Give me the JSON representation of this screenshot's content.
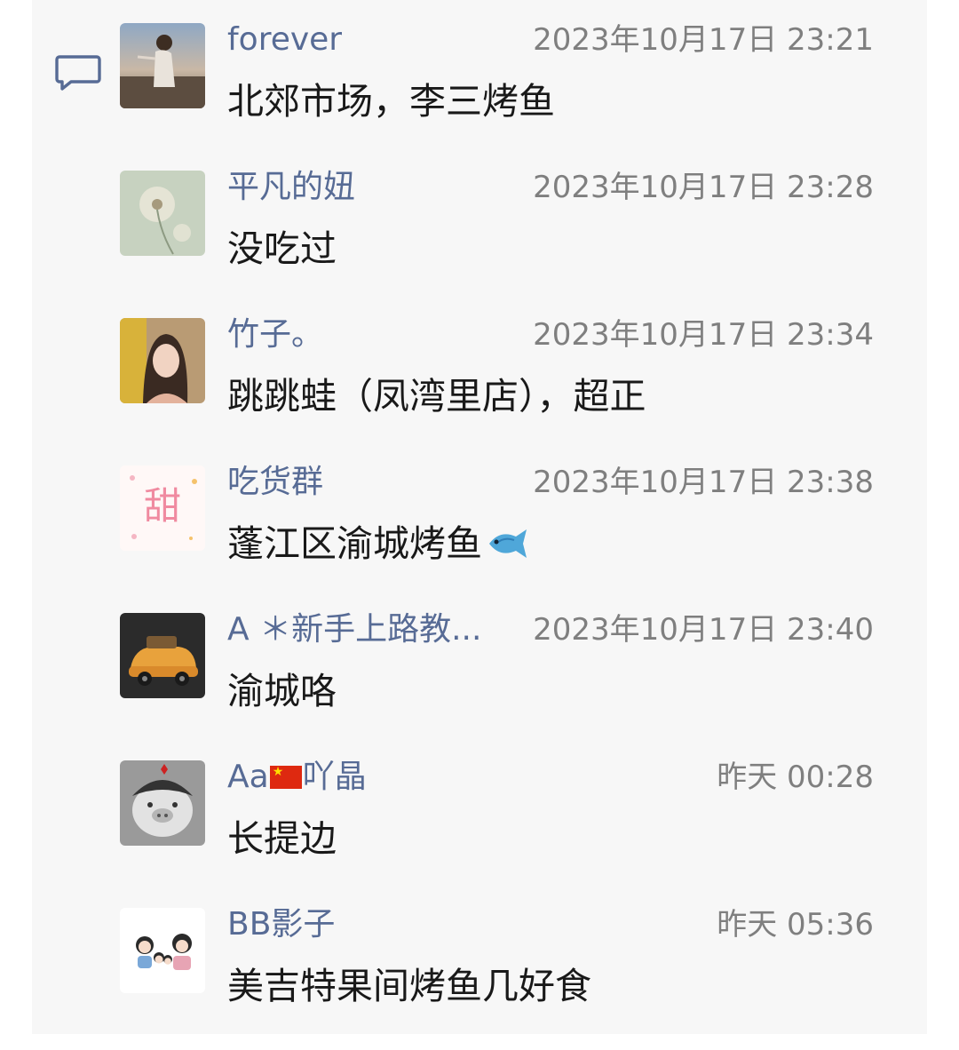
{
  "comments": [
    {
      "nickname": "forever",
      "time": "2023年10月17日 23:21",
      "message": "北郊市场，李三烤鱼",
      "avatar": "avatar-photo-woman-beach"
    },
    {
      "nickname": "平凡的妞",
      "time": "2023年10月17日 23:28",
      "message": "没吃过",
      "avatar": "avatar-dandelion"
    },
    {
      "nickname": "竹子。",
      "time": "2023年10月17日 23:34",
      "message": "跳跳蛙（凤湾里店），超正",
      "avatar": "avatar-photo-woman-selfie"
    },
    {
      "nickname": "吃货群",
      "time": "2023年10月17日 23:38",
      "message": "蓬江区渝城烤鱼",
      "message_emoji": "fish-emoji",
      "avatar": "avatar-sweet-text",
      "avatar_text": "甜"
    },
    {
      "nickname": "A ＊新手上路教...",
      "time": "2023年10月17日 23:40",
      "message": "渝城咯",
      "avatar": "avatar-cartoon-car"
    },
    {
      "nickname_prefix": "Aa",
      "nickname_flag": "china-flag-emoji",
      "nickname_suffix": "吖晶",
      "time": "昨天 00:28",
      "message": "长提边",
      "avatar": "avatar-cartoon-pig"
    },
    {
      "nickname": "BB影子",
      "time": "昨天 05:36",
      "message": "美吉特果间烤鱼几好食",
      "avatar": "avatar-cartoon-family"
    }
  ],
  "colors": {
    "nickname": "#576b95",
    "time": "#7f7f7f",
    "message": "#191919",
    "panel": "#f7f7f7"
  }
}
